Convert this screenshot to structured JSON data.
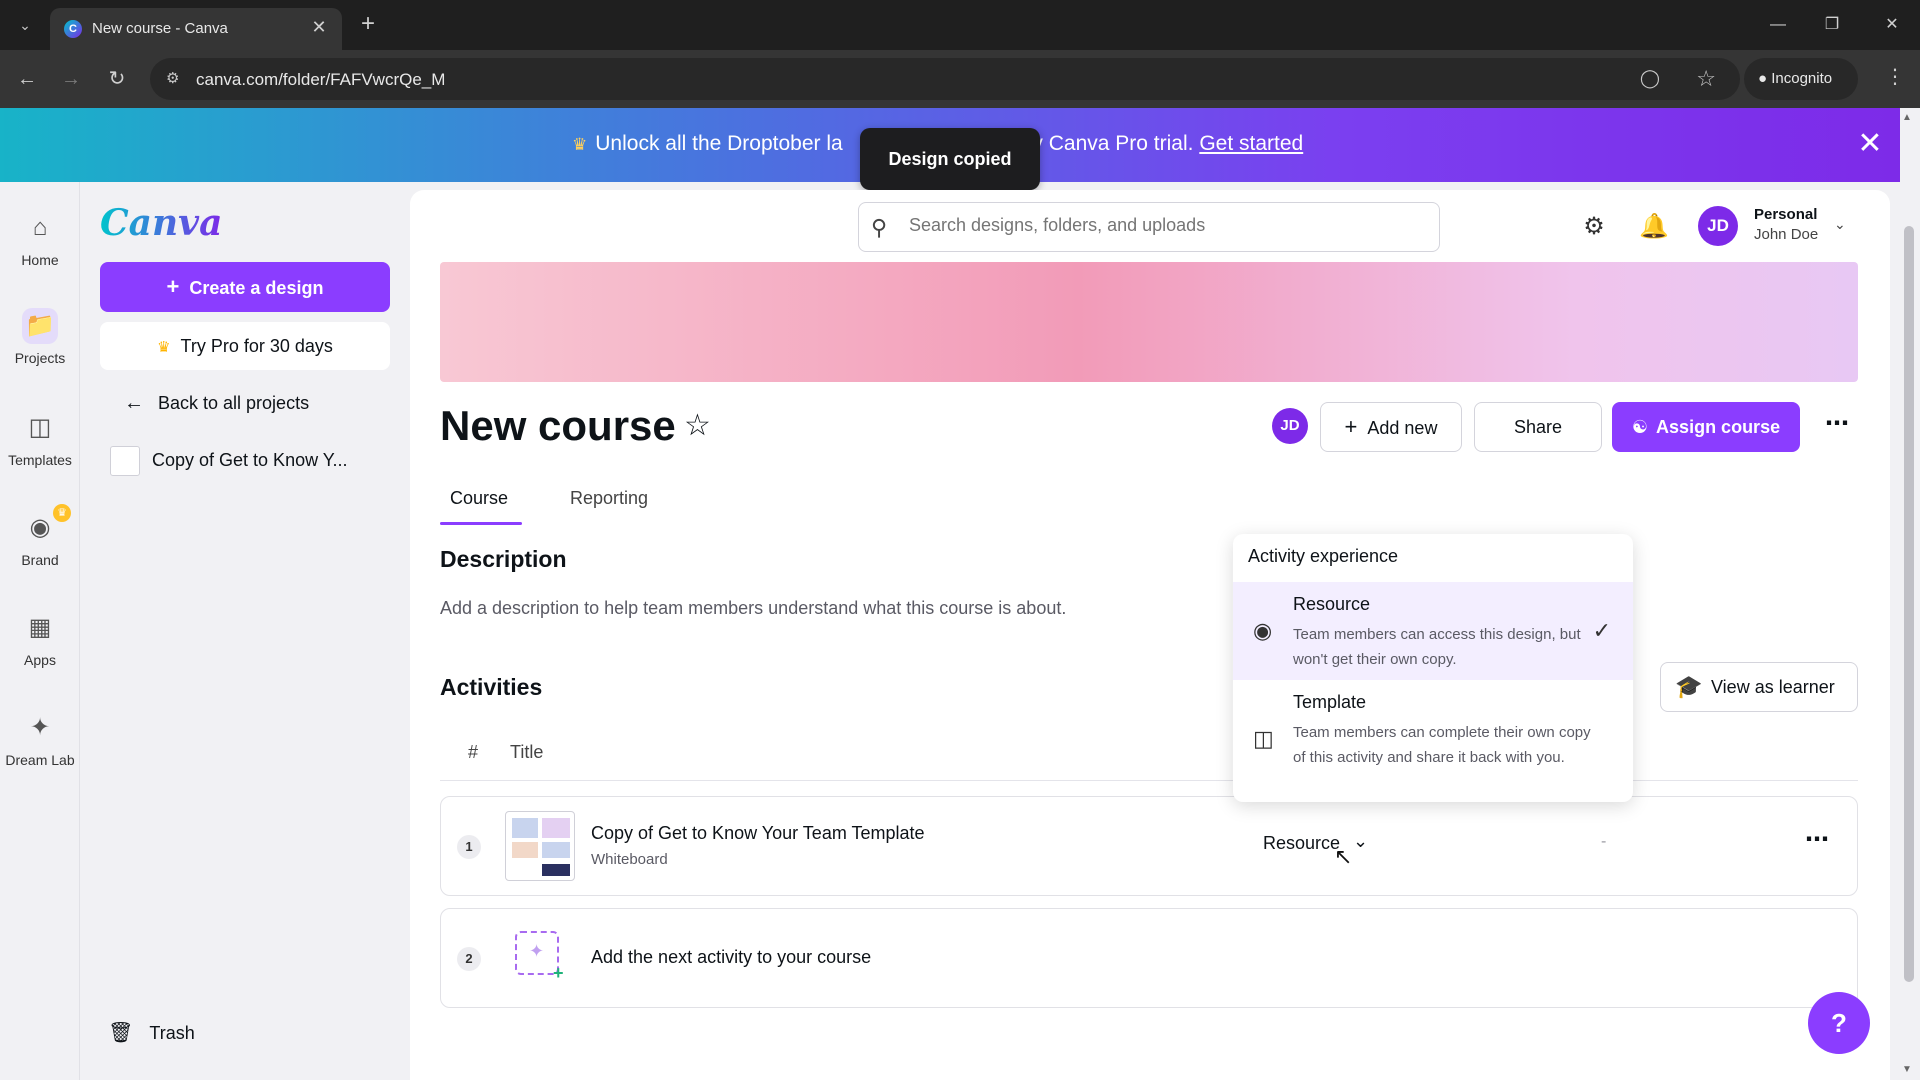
{
  "browser": {
    "tab_list_icon": "chevron-down-icon",
    "tab_title": "New course - Canva",
    "favicon": "canva-favicon",
    "url": "canva.com/folder/FAFVwcrQe_M",
    "incognito_label": "Incognito"
  },
  "promo": {
    "text_prefix": "Unlock all the Droptober la",
    "text_suffix": "ay Canva Pro trial.",
    "link": "Get started"
  },
  "toast": {
    "text": "Design copied"
  },
  "rail": {
    "home": "Home",
    "projects": "Projects",
    "templates": "Templates",
    "brand": "Brand",
    "apps": "Apps",
    "dream_lab": "Dream Lab"
  },
  "sidebar": {
    "logo": "Canva",
    "create_button": "Create a design",
    "try_pro": "Try Pro for 30 days",
    "back_link": "Back to all projects",
    "recent_item": "Copy of Get to Know Y...",
    "trash": "Trash"
  },
  "header": {
    "search_placeholder": "Search designs, folders, and uploads",
    "avatar_initials": "JD",
    "account_type": "Personal",
    "user_name": "John Doe"
  },
  "course": {
    "title": "New course",
    "owner_initials": "JD",
    "add_new": "Add new",
    "share": "Share",
    "assign": "Assign course",
    "tabs": [
      "Course",
      "Reporting"
    ],
    "description_heading": "Description",
    "description_placeholder": "Add a description to help team members understand what this course is about.",
    "activities_heading": "Activities",
    "view_as_learner": "View as learner",
    "columns": {
      "number": "#",
      "title": "Title"
    }
  },
  "activities": [
    {
      "number": "1",
      "title": "Copy of Get to Know Your Team Template",
      "type": "Whiteboard",
      "experience": "Resource",
      "status": "-"
    }
  ],
  "add_activity": {
    "number": "2",
    "label": "Add the next activity to your course"
  },
  "dropdown": {
    "heading": "Activity experience",
    "options": [
      {
        "title": "Resource",
        "description": "Team members can access this design, but won't get their own copy.",
        "icon": "eye-icon",
        "selected": true
      },
      {
        "title": "Template",
        "description": "Team members can complete their own copy of this activity and share it back with you.",
        "icon": "template-icon",
        "selected": false
      }
    ]
  },
  "help": {
    "label": "?"
  },
  "colors": {
    "accent": "#8b3dff",
    "brand_purple": "#7d2ae8"
  }
}
